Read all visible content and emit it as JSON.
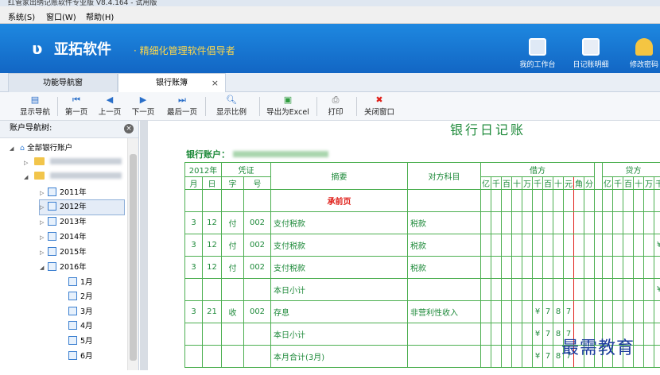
{
  "window": {
    "title": "红管家出纳记账软件专业版 V8.4.164 - 试用版"
  },
  "menu": [
    "系统(S)",
    "窗口(W)",
    "帮助(H)"
  ],
  "banner": {
    "brand": "亚拓软件",
    "slogan": "· 精细化管理软件倡导者",
    "buttons": [
      "我的工作台",
      "日记账明细",
      "修改密码"
    ]
  },
  "tabs": [
    "功能导航窗",
    "银行账簿"
  ],
  "toolbar": [
    "显示导航",
    "第一页",
    "上一页",
    "下一页",
    "最后一页",
    "显示比例",
    "导出为Excel",
    "打印",
    "关闭窗口"
  ],
  "sidebar": {
    "title": "账户导航树:",
    "root": "全部银行账户",
    "years": [
      "2011年",
      "2012年",
      "2013年",
      "2014年",
      "2015年",
      "2016年"
    ],
    "months": [
      "1月",
      "2月",
      "3月",
      "4月",
      "5月",
      "6月"
    ]
  },
  "ledger": {
    "title": "银行日记账",
    "account_label": "银行账户：",
    "year_header": "2012年",
    "voucher_header": "凭证",
    "summary_header": "摘要",
    "counter_header": "对方科目",
    "debit_header": "借方",
    "credit_header": "贷方",
    "sub_month": "月",
    "sub_day": "日",
    "sub_word": "字",
    "sub_num": "号",
    "digits": [
      "亿",
      "千",
      "百",
      "十",
      "万",
      "千",
      "百",
      "十",
      "元",
      "角",
      "分"
    ],
    "credit_digits": [
      "亿",
      "千",
      "百",
      "十",
      "万",
      "千"
    ],
    "carry_forward": "承前页",
    "rows": [
      {
        "m": "3",
        "d": "12",
        "w": "付",
        "n": "002",
        "summary": "支付税款",
        "counter": "税款",
        "debit": "",
        "credit_tail": ""
      },
      {
        "m": "3",
        "d": "12",
        "w": "付",
        "n": "002",
        "summary": "支付税款",
        "counter": "税款",
        "debit": "",
        "credit_tail": "¥"
      },
      {
        "m": "3",
        "d": "12",
        "w": "付",
        "n": "002",
        "summary": "支付税款",
        "counter": "税款",
        "debit": "",
        "credit_tail": ""
      },
      {
        "m": "",
        "d": "",
        "w": "",
        "n": "",
        "summary": "本日小计",
        "counter": "",
        "debit": "",
        "credit_tail": "¥"
      },
      {
        "m": "3",
        "d": "21",
        "w": "收",
        "n": "002",
        "summary": "存息",
        "counter": "非营利性收入",
        "debit": "¥787",
        "credit_tail": ""
      },
      {
        "m": "",
        "d": "",
        "w": "",
        "n": "",
        "summary": "本日小计",
        "counter": "",
        "debit": "¥787",
        "credit_tail": ""
      },
      {
        "m": "",
        "d": "",
        "w": "",
        "n": "",
        "summary": "本月合计(3月)",
        "counter": "",
        "debit": "¥787",
        "credit_tail": ""
      }
    ]
  },
  "watermark": "最需教育"
}
